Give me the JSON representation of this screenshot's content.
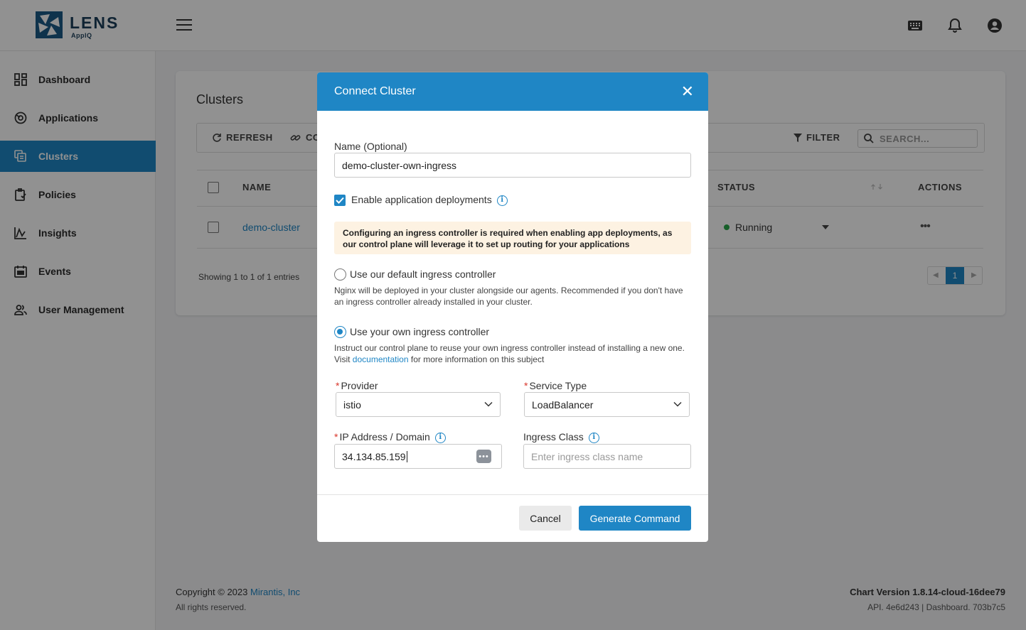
{
  "app": {
    "logo_text": "LENS",
    "logo_sub": "AppIQ"
  },
  "sidebar": {
    "items": [
      {
        "label": "Dashboard",
        "icon": "dashboard-icon"
      },
      {
        "label": "Applications",
        "icon": "applications-icon"
      },
      {
        "label": "Clusters",
        "icon": "clusters-icon",
        "active": true
      },
      {
        "label": "Policies",
        "icon": "policies-icon"
      },
      {
        "label": "Insights",
        "icon": "insights-icon"
      },
      {
        "label": "Events",
        "icon": "events-icon"
      },
      {
        "label": "User Management",
        "icon": "users-icon"
      }
    ]
  },
  "page": {
    "title": "Clusters",
    "toolbar": {
      "refresh_label": "REFRESH",
      "connect_label": "CO",
      "filter_label": "FILTER",
      "search_placeholder": "SEARCH..."
    },
    "table": {
      "columns": [
        "NAME",
        "STATUS",
        "ACTIONS"
      ],
      "rows": [
        {
          "name": "demo-cluster",
          "status": "Running",
          "actions": "•••"
        }
      ]
    },
    "showing": "Showing 1 to 1 of 1 entries",
    "pagination": {
      "current": "1"
    }
  },
  "footer": {
    "copyright_prefix": "Copyright © 2023 ",
    "company": "Mirantis, Inc",
    "rights": "All rights reserved.",
    "chart_version": "Chart Version 1.8.14-cloud-16dee79",
    "api_version": "API. 4e6d243 | Dashboard. 703b7c5"
  },
  "modal": {
    "title": "Connect Cluster",
    "name_label": "Name (Optional)",
    "name_value": "demo-cluster-own-ingress",
    "enable_label": "Enable application deployments",
    "enable_checked": true,
    "warning_text": "Configuring an ingress controller is required when enabling app deployments, as our control plane will leverage it to set up routing for your applications",
    "option_default_label": "Use our default ingress controller",
    "option_default_help": "Nginx will be deployed in your cluster alongside our agents. Recommended if you don't have an ingress controller already installed in your cluster.",
    "option_own_label": "Use your own ingress controller",
    "option_own_help_before": "Instruct our control plane to reuse your own ingress controller instead of installing a new one. Visit ",
    "option_own_help_link": "documentation",
    "option_own_help_after": " for more information on this subject",
    "selected_option": "own",
    "provider_label": "Provider",
    "provider_value": "istio",
    "service_type_label": "Service Type",
    "service_type_value": "LoadBalancer",
    "ip_label": "IP Address / Domain",
    "ip_value": "34.134.85.159",
    "ingress_class_label": "Ingress Class",
    "ingress_class_placeholder": "Enter ingress class name",
    "cancel_label": "Cancel",
    "generate_label": "Generate Command"
  },
  "colors": {
    "accent": "#1f86c5",
    "warning_bg": "#fdf2e2",
    "status_running": "#2aa84a",
    "required": "#d9362b"
  }
}
